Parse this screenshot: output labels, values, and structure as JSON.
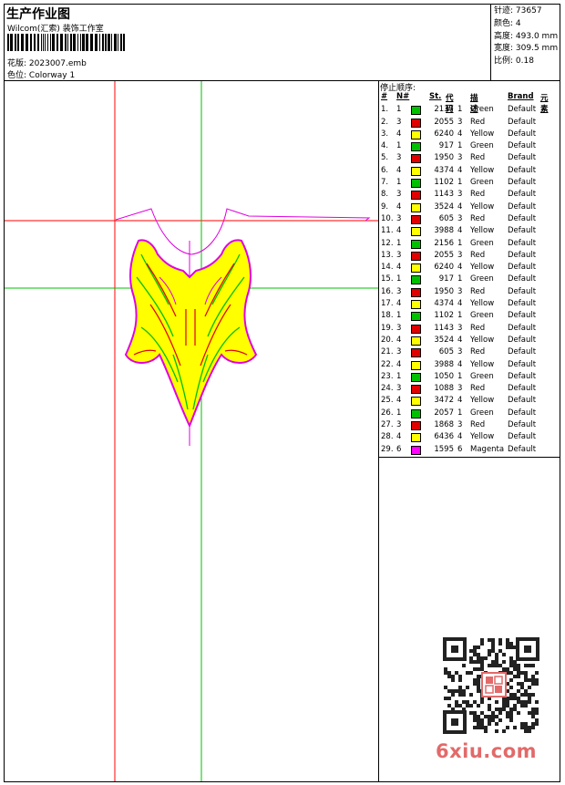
{
  "header": {
    "title": "生产作业图",
    "company": "Wilcom(汇索) 装饰工作室",
    "design_label": "花版:",
    "design_value": "2023007.emb",
    "colorway_label": "色位:",
    "colorway_value": "Colorway 1"
  },
  "stats": [
    {
      "label": "针迹:",
      "value": "73657"
    },
    {
      "label": "颜色:",
      "value": "4"
    },
    {
      "label": "高度:",
      "value": "493.0 mm"
    },
    {
      "label": "宽度:",
      "value": "309.5 mm"
    },
    {
      "label": "比例:",
      "value": "0.18"
    }
  ],
  "stop_sequence": {
    "title": "停止顺序:",
    "headers": [
      "#",
      "N#",
      "St.",
      "代码",
      "描述",
      "Brand",
      "元素"
    ],
    "rows": [
      {
        "idx": "1.",
        "n": "1",
        "st": "2137",
        "code": "1",
        "desc": "Green",
        "brand": "Default",
        "color": "#00c000"
      },
      {
        "idx": "2.",
        "n": "3",
        "st": "2055",
        "code": "3",
        "desc": "Red",
        "brand": "Default",
        "color": "#e00000"
      },
      {
        "idx": "3.",
        "n": "4",
        "st": "6240",
        "code": "4",
        "desc": "Yellow",
        "brand": "Default",
        "color": "#ffff00"
      },
      {
        "idx": "4.",
        "n": "1",
        "st": "917",
        "code": "1",
        "desc": "Green",
        "brand": "Default",
        "color": "#00c000"
      },
      {
        "idx": "5.",
        "n": "3",
        "st": "1950",
        "code": "3",
        "desc": "Red",
        "brand": "Default",
        "color": "#e00000"
      },
      {
        "idx": "6.",
        "n": "4",
        "st": "4374",
        "code": "4",
        "desc": "Yellow",
        "brand": "Default",
        "color": "#ffff00"
      },
      {
        "idx": "7.",
        "n": "1",
        "st": "1102",
        "code": "1",
        "desc": "Green",
        "brand": "Default",
        "color": "#00c000"
      },
      {
        "idx": "8.",
        "n": "3",
        "st": "1143",
        "code": "3",
        "desc": "Red",
        "brand": "Default",
        "color": "#e00000"
      },
      {
        "idx": "9.",
        "n": "4",
        "st": "3524",
        "code": "4",
        "desc": "Yellow",
        "brand": "Default",
        "color": "#ffff00"
      },
      {
        "idx": "10.",
        "n": "3",
        "st": "605",
        "code": "3",
        "desc": "Red",
        "brand": "Default",
        "color": "#e00000"
      },
      {
        "idx": "11.",
        "n": "4",
        "st": "3988",
        "code": "4",
        "desc": "Yellow",
        "brand": "Default",
        "color": "#ffff00"
      },
      {
        "idx": "12.",
        "n": "1",
        "st": "2156",
        "code": "1",
        "desc": "Green",
        "brand": "Default",
        "color": "#00c000"
      },
      {
        "idx": "13.",
        "n": "3",
        "st": "2055",
        "code": "3",
        "desc": "Red",
        "brand": "Default",
        "color": "#e00000"
      },
      {
        "idx": "14.",
        "n": "4",
        "st": "6240",
        "code": "4",
        "desc": "Yellow",
        "brand": "Default",
        "color": "#ffff00"
      },
      {
        "idx": "15.",
        "n": "1",
        "st": "917",
        "code": "1",
        "desc": "Green",
        "brand": "Default",
        "color": "#00c000"
      },
      {
        "idx": "16.",
        "n": "3",
        "st": "1950",
        "code": "3",
        "desc": "Red",
        "brand": "Default",
        "color": "#e00000"
      },
      {
        "idx": "17.",
        "n": "4",
        "st": "4374",
        "code": "4",
        "desc": "Yellow",
        "brand": "Default",
        "color": "#ffff00"
      },
      {
        "idx": "18.",
        "n": "1",
        "st": "1102",
        "code": "1",
        "desc": "Green",
        "brand": "Default",
        "color": "#00c000"
      },
      {
        "idx": "19.",
        "n": "3",
        "st": "1143",
        "code": "3",
        "desc": "Red",
        "brand": "Default",
        "color": "#e00000"
      },
      {
        "idx": "20.",
        "n": "4",
        "st": "3524",
        "code": "4",
        "desc": "Yellow",
        "brand": "Default",
        "color": "#ffff00"
      },
      {
        "idx": "21.",
        "n": "3",
        "st": "605",
        "code": "3",
        "desc": "Red",
        "brand": "Default",
        "color": "#e00000"
      },
      {
        "idx": "22.",
        "n": "4",
        "st": "3988",
        "code": "4",
        "desc": "Yellow",
        "brand": "Default",
        "color": "#ffff00"
      },
      {
        "idx": "23.",
        "n": "1",
        "st": "1050",
        "code": "1",
        "desc": "Green",
        "brand": "Default",
        "color": "#00c000"
      },
      {
        "idx": "24.",
        "n": "3",
        "st": "1088",
        "code": "3",
        "desc": "Red",
        "brand": "Default",
        "color": "#e00000"
      },
      {
        "idx": "25.",
        "n": "4",
        "st": "3472",
        "code": "4",
        "desc": "Yellow",
        "brand": "Default",
        "color": "#ffff00"
      },
      {
        "idx": "26.",
        "n": "1",
        "st": "2057",
        "code": "1",
        "desc": "Green",
        "brand": "Default",
        "color": "#00c000"
      },
      {
        "idx": "27.",
        "n": "3",
        "st": "1868",
        "code": "3",
        "desc": "Red",
        "brand": "Default",
        "color": "#e00000"
      },
      {
        "idx": "28.",
        "n": "4",
        "st": "6436",
        "code": "4",
        "desc": "Yellow",
        "brand": "Default",
        "color": "#ffff00"
      },
      {
        "idx": "29.",
        "n": "6",
        "st": "1595",
        "code": "6",
        "desc": "Magenta",
        "brand": "Default",
        "color": "#ff00ff"
      }
    ]
  },
  "watermark": {
    "text": "6xiu.com",
    "color": "#e26a6a"
  },
  "colors": {
    "guide_red": "#ff0000",
    "guide_green": "#00c000",
    "outline_magenta": "#e000e0",
    "fill_yellow": "#ffff00"
  }
}
